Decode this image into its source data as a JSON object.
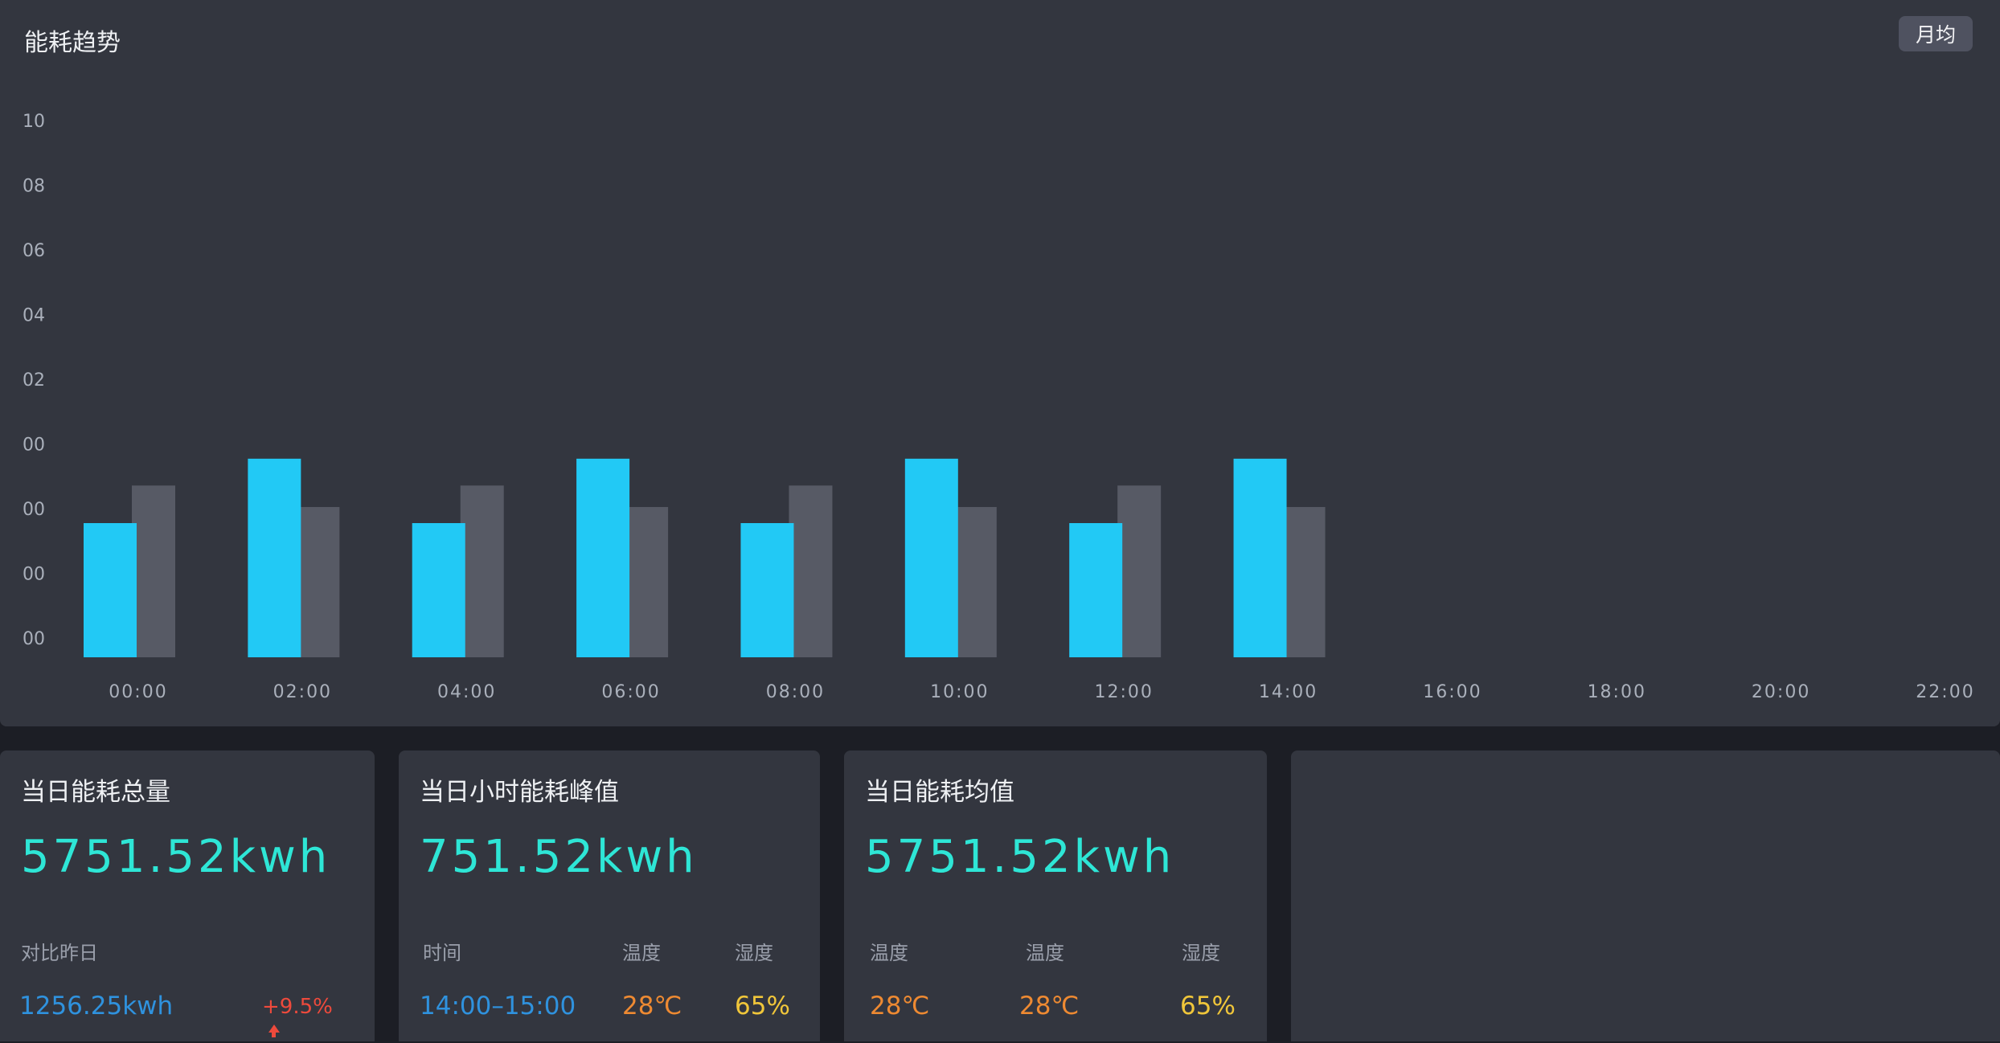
{
  "chart_panel": {
    "title": "能耗趋势",
    "toggle_label": "月均"
  },
  "chart_data": {
    "type": "bar",
    "title": "能耗趋势",
    "y_tick_labels": [
      "10",
      "08",
      "06",
      "04",
      "02",
      "00",
      "00",
      "00",
      "00"
    ],
    "x_tick_labels": [
      "00:00",
      "02:00",
      "04:00",
      "06:00",
      "08:00",
      "10:00",
      "12:00",
      "14:00",
      "16:00",
      "18:00",
      "20:00",
      "22:00"
    ],
    "categories": [
      "00:00",
      "02:00",
      "04:00",
      "06:00",
      "08:00",
      "10:00",
      "12:00",
      "14:00"
    ],
    "series": [
      {
        "color": "#22c9f5",
        "values": [
          2.5,
          3.7,
          2.5,
          3.7,
          2.5,
          3.7,
          2.5,
          3.7
        ]
      },
      {
        "color": "#575a65",
        "values": [
          3.2,
          2.8,
          3.2,
          2.8,
          3.2,
          2.8,
          3.2,
          2.8
        ]
      }
    ],
    "ylim": [
      0,
      10
    ],
    "grid": false,
    "legend": "none"
  },
  "cards": [
    {
      "title": "当日能耗总量",
      "value": "5751.52kwh",
      "label": "对比昨日",
      "compare_value": "1256.25kwh",
      "change": "+9.5%"
    },
    {
      "title": "当日小时能耗峰值",
      "value": "751.52kwh",
      "labels": [
        "时间",
        "温度",
        "湿度"
      ],
      "values": [
        "14:00–15:00",
        "28℃",
        "65%"
      ]
    },
    {
      "title": "当日能耗均值",
      "value": "5751.52kwh",
      "labels": [
        "温度",
        "温度",
        "湿度"
      ],
      "values": [
        "28℃",
        "28℃",
        "65%"
      ]
    }
  ],
  "colors": {
    "accent": "#2ee6d6",
    "bar_primary": "#22c9f5",
    "bar_secondary": "#575a65",
    "blue_text": "#2f92de",
    "orange_text": "#ee8a32",
    "yellow_text": "#f0c63a",
    "red_text": "#ee4a3c"
  },
  "icons": {
    "trend": "arrow-up-icon"
  }
}
